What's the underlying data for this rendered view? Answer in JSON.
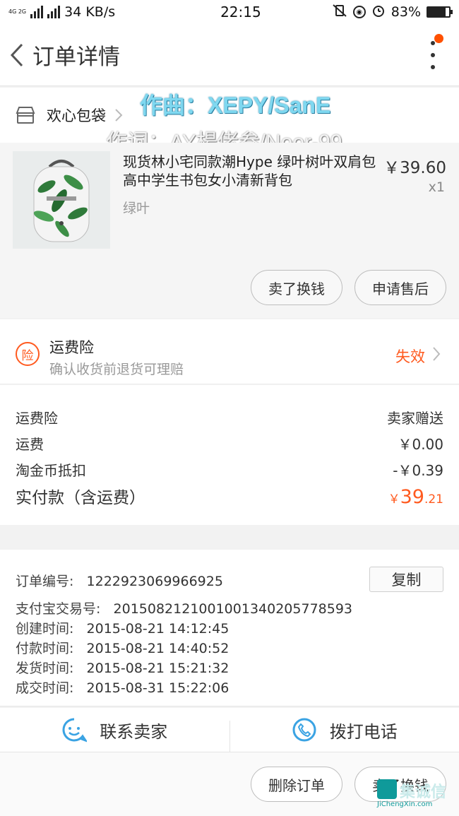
{
  "status_bar": {
    "network": "4G 2G",
    "speed": "34 KB/s",
    "time": "22:15",
    "battery": "83%",
    "battery_level": 0.83
  },
  "navbar": {
    "title": "订单详情"
  },
  "shop": {
    "name": "欢心包袋"
  },
  "credits": {
    "composer": "作曲：XEPY/SanE",
    "lyricist": "作词：AY楊佬叁/Noor-99"
  },
  "item": {
    "title": "现货林小宅同款潮Hype 绿叶树叶双肩包高中学生书包女小清新背包",
    "sku": "绿叶",
    "price": "￥39.60",
    "quantity": "x1",
    "buttons": {
      "sell": "卖了换钱",
      "after_sale": "申请售后"
    }
  },
  "insurance": {
    "badge": "险",
    "title": "运费险",
    "subtitle": "确认收货前退货可理赔",
    "status": "失效"
  },
  "fees": [
    {
      "label": "运费险",
      "value": "卖家赠送"
    },
    {
      "label": "运费",
      "value": "￥0.00"
    },
    {
      "label": "淘金币抵扣",
      "value": "-￥0.39"
    }
  ],
  "total": {
    "label": "实付款（含运费）",
    "currency": "￥",
    "integer": "39",
    "decimal": ".21"
  },
  "order_info": {
    "copy_label": "复制",
    "rows": [
      {
        "label": "订单编号:",
        "value": "1222923069966925"
      },
      {
        "label": "支付宝交易号:",
        "value": "2015082121001001340205778593"
      },
      {
        "label": "创建时间:",
        "value": "2015-08-21 14:12:45"
      },
      {
        "label": "付款时间:",
        "value": "2015-08-21 14:40:52"
      },
      {
        "label": "发货时间:",
        "value": "2015-08-21 15:21:32"
      },
      {
        "label": "成交时间:",
        "value": "2015-08-31 15:22:06"
      }
    ]
  },
  "contact": {
    "seller": "联系卖家",
    "phone": "拨打电话"
  },
  "bottom": {
    "delete": "删除订单",
    "sell": "卖了换钱"
  },
  "watermark": {
    "brand": "集诚信",
    "url": "JiChengXin.com"
  },
  "colors": {
    "accent": "#ff5a1f",
    "notify": "#ff5000",
    "icon_blue": "#3aa3e3"
  }
}
